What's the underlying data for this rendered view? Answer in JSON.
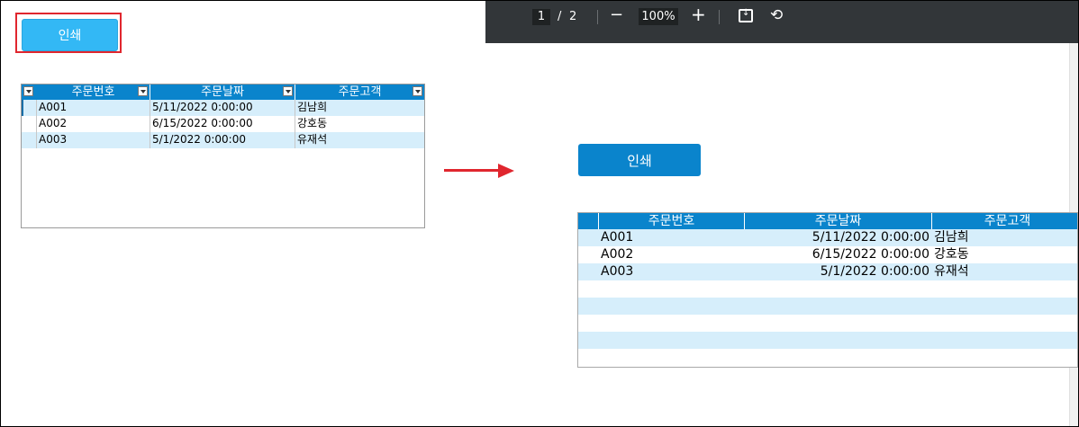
{
  "left_app": {
    "print_button": "인쇄",
    "grid": {
      "columns": [
        "주문번호",
        "주문날짜",
        "주문고객"
      ],
      "rows": [
        {
          "id": "A001",
          "date": "5/11/2022 0:00:00",
          "customer": "김남희"
        },
        {
          "id": "A002",
          "date": "6/15/2022 0:00:00",
          "customer": "강호동"
        },
        {
          "id": "A003",
          "date": "5/1/2022 0:00:00",
          "customer": "유재석"
        }
      ]
    }
  },
  "pdf_viewer": {
    "page_current": "1",
    "page_separator": "/",
    "page_total": "2",
    "zoom_minus": "−",
    "zoom_level": "100%",
    "zoom_plus": "+",
    "print_button": "인쇄",
    "grid": {
      "columns": [
        "주문번호",
        "주문날짜",
        "주문고객"
      ],
      "rows": [
        {
          "id": "A001",
          "date": "5/11/2022 0:00:00",
          "customer": "김남희"
        },
        {
          "id": "A002",
          "date": "6/15/2022 0:00:00",
          "customer": "강호동"
        },
        {
          "id": "A003",
          "date": "5/1/2022 0:00:00",
          "customer": "유재석"
        }
      ]
    }
  },
  "colors": {
    "accent_blue": "#0a84cc",
    "button_light_blue": "#33b8f5",
    "highlight_red": "#e0262e",
    "row_alt": "#d6eefb",
    "toolbar_bg": "#323639"
  },
  "icons": [
    "fit-to-page-icon",
    "rotate-icon",
    "dropdown-arrow-icon",
    "arrow-right-icon"
  ]
}
